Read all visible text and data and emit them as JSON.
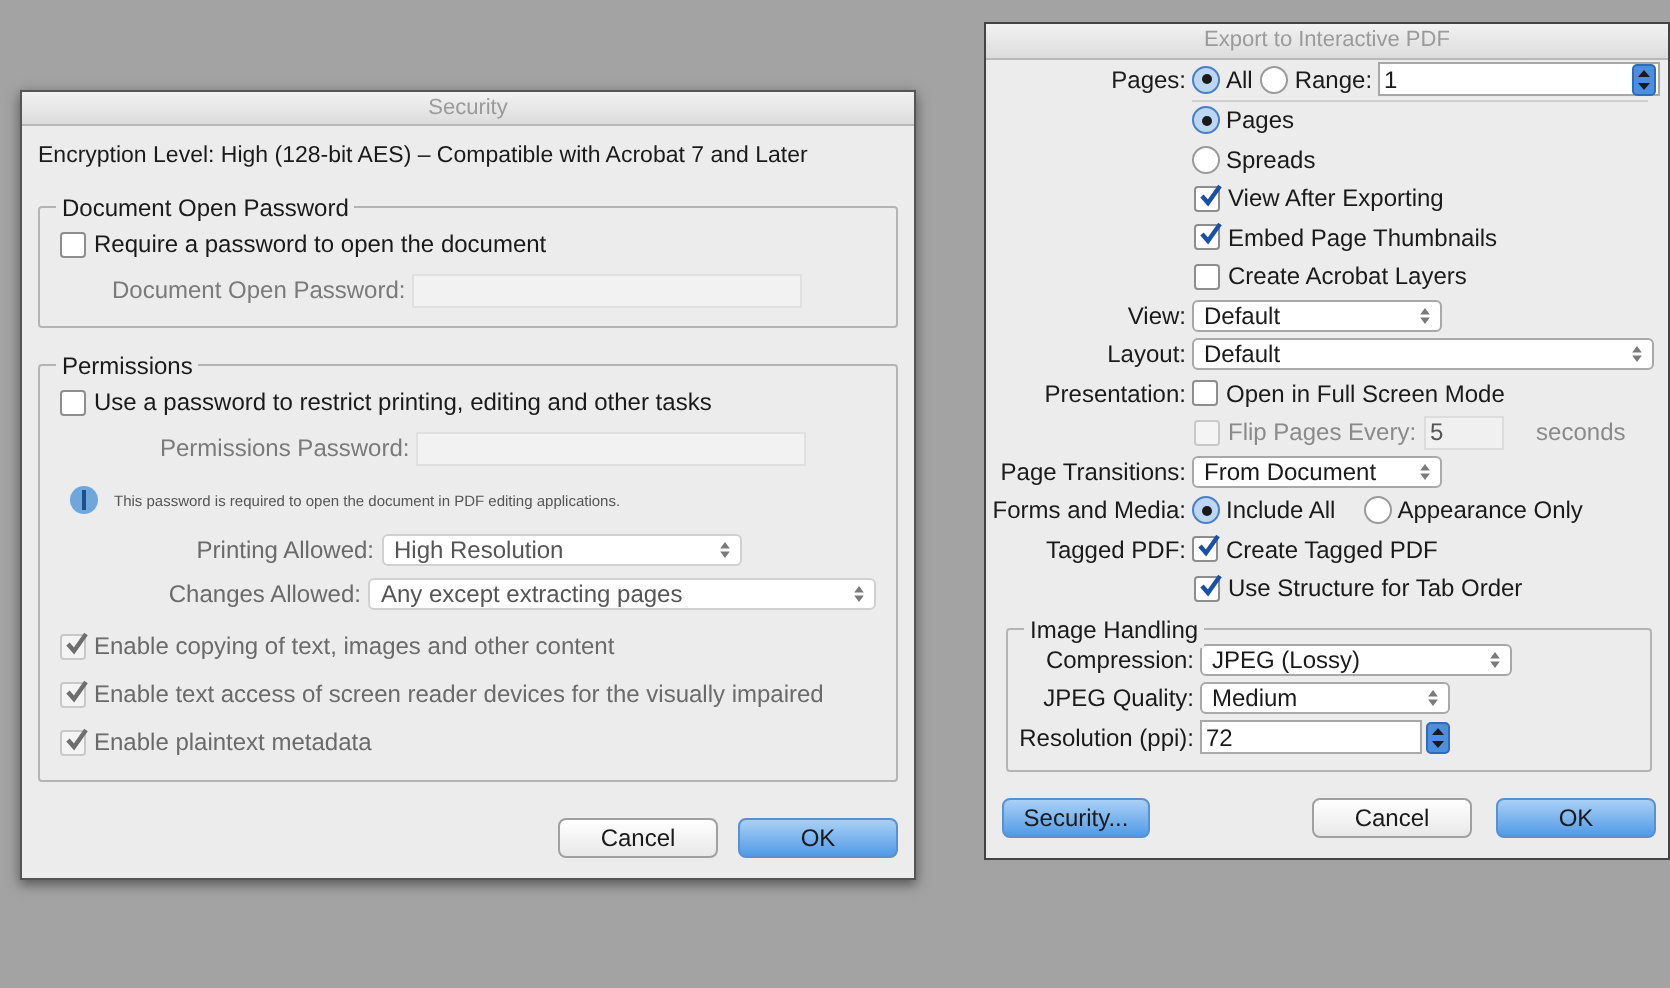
{
  "security_dialog": {
    "title": "Security",
    "encryption_level": "Encryption Level: High (128-bit AES) – Compatible with Acrobat 7 and Later",
    "open_password_group": {
      "legend": "Document Open Password",
      "require": {
        "label": "Require a password to open the document",
        "checked": false
      },
      "password": {
        "label": "Document Open Password:",
        "disabled": true
      }
    },
    "permissions_group": {
      "legend": "Permissions",
      "use_password": {
        "label": "Use a password to restrict printing, editing and other tasks",
        "checked": false
      },
      "password": {
        "label": "Permissions Password:",
        "disabled": true
      },
      "info": "This password is required to open the document in PDF editing applications.",
      "printing": {
        "label": "Printing Allowed:",
        "value": "High Resolution",
        "disabled": true
      },
      "changes": {
        "label": "Changes Allowed:",
        "value": "Any except extracting pages",
        "disabled": true
      },
      "options": [
        {
          "label": "Enable copying of text, images and other content",
          "checked": true,
          "disabled": true
        },
        {
          "label": "Enable text access of screen reader devices for the visually impaired",
          "checked": true,
          "disabled": true
        },
        {
          "label": "Enable plaintext metadata",
          "checked": true,
          "disabled": true
        }
      ]
    },
    "buttons": [
      {
        "label": "Cancel",
        "primary": false
      },
      {
        "label": "OK",
        "primary": true
      }
    ]
  },
  "export_dialog": {
    "title": "Export to Interactive PDF",
    "pages": {
      "label": "Pages:",
      "options": [
        {
          "label": "All",
          "selected": true
        },
        {
          "label": "Range:",
          "selected": false
        }
      ],
      "range_value": "1"
    },
    "page_mode": [
      {
        "label": "Pages",
        "selected": true
      },
      {
        "label": "Spreads",
        "selected": false
      }
    ],
    "options": [
      {
        "label": "View After Exporting",
        "checked": true
      },
      {
        "label": "Embed Page Thumbnails",
        "checked": true
      },
      {
        "label": "Create Acrobat Layers",
        "checked": false
      }
    ],
    "view": {
      "label": "View:",
      "value": "Default"
    },
    "layout": {
      "label": "Layout:",
      "value": "Default"
    },
    "presentation": {
      "label": "Presentation:",
      "full_screen": {
        "label": "Open in Full Screen Mode",
        "checked": false
      },
      "flip": {
        "label": "Flip Pages Every:",
        "checked": false,
        "disabled": true,
        "value": "5",
        "unit": "seconds"
      }
    },
    "page_transitions": {
      "label": "Page Transitions:",
      "value": "From Document"
    },
    "forms_and_media": {
      "label": "Forms and Media:",
      "options": [
        {
          "label": "Include All",
          "selected": true
        },
        {
          "label": "Appearance Only",
          "selected": false
        }
      ]
    },
    "tagged_pdf": {
      "label": "Tagged PDF:",
      "options": [
        {
          "label": "Create Tagged PDF",
          "checked": true
        },
        {
          "label": "Use Structure for Tab Order",
          "checked": true
        }
      ]
    },
    "image_handling": {
      "legend": "Image Handling",
      "compression": {
        "label": "Compression:",
        "value": "JPEG (Lossy)"
      },
      "jpeg_quality": {
        "label": "JPEG Quality:",
        "value": "Medium"
      },
      "resolution": {
        "label": "Resolution (ppi):",
        "value": "72"
      }
    },
    "buttons": [
      {
        "label": "Security...",
        "primary": true
      },
      {
        "label": "Cancel",
        "primary": false
      },
      {
        "label": "OK",
        "primary": true
      }
    ]
  }
}
